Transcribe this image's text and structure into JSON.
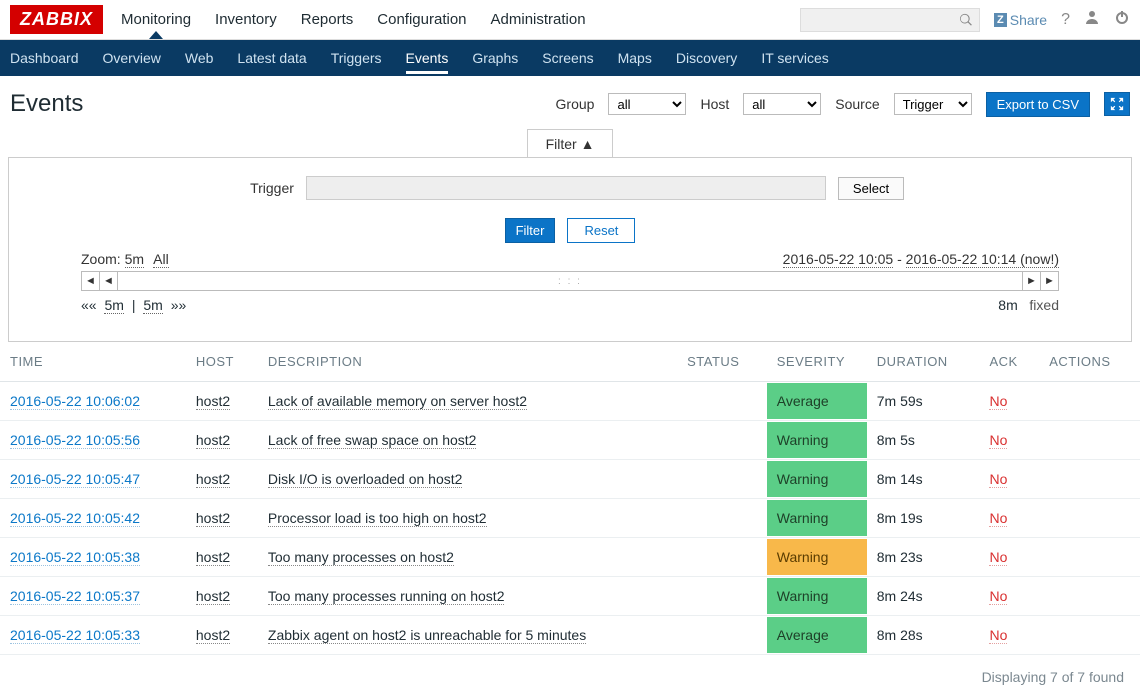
{
  "logo": "ZABBIX",
  "topnav": [
    {
      "label": "Monitoring",
      "active": true
    },
    {
      "label": "Inventory",
      "active": false
    },
    {
      "label": "Reports",
      "active": false
    },
    {
      "label": "Configuration",
      "active": false
    },
    {
      "label": "Administration",
      "active": false
    }
  ],
  "share_label": "Share",
  "subnav": [
    {
      "label": "Dashboard",
      "active": false
    },
    {
      "label": "Overview",
      "active": false
    },
    {
      "label": "Web",
      "active": false
    },
    {
      "label": "Latest data",
      "active": false
    },
    {
      "label": "Triggers",
      "active": false
    },
    {
      "label": "Events",
      "active": true
    },
    {
      "label": "Graphs",
      "active": false
    },
    {
      "label": "Screens",
      "active": false
    },
    {
      "label": "Maps",
      "active": false
    },
    {
      "label": "Discovery",
      "active": false
    },
    {
      "label": "IT services",
      "active": false
    }
  ],
  "page_title": "Events",
  "selects": {
    "group_label": "Group",
    "group_value": "all",
    "host_label": "Host",
    "host_value": "all",
    "source_label": "Source",
    "source_value": "Trigger"
  },
  "export_btn": "Export to CSV",
  "filter_tab": "Filter ▲",
  "filter": {
    "trigger_label": "Trigger",
    "select_btn": "Select",
    "filter_btn": "Filter",
    "reset_btn": "Reset"
  },
  "zoom": {
    "label": "Zoom:",
    "opt1": "5m",
    "opt2": "All",
    "range_from": "2016-05-22 10:05",
    "range_sep": " - ",
    "range_to": "2016-05-22 10:14 (now!)"
  },
  "zoom2": {
    "left_dbl_l": "««",
    "left_5m_a": "5m",
    "left_sep": " | ",
    "left_5m_b": "5m",
    "left_dbl_r": "»»",
    "right_8m": "8m",
    "right_fixed": "fixed"
  },
  "headers": {
    "time": "TIME",
    "host": "HOST",
    "description": "DESCRIPTION",
    "status": "STATUS",
    "severity": "SEVERITY",
    "duration": "DURATION",
    "ack": "ACK",
    "actions": "ACTIONS"
  },
  "rows": [
    {
      "time": "2016-05-22 10:06:02",
      "host": "host2",
      "desc": "Lack of available memory on server host2",
      "status": "",
      "sev": "Average",
      "sev_color": "green",
      "dur": "7m 59s",
      "ack": "No"
    },
    {
      "time": "2016-05-22 10:05:56",
      "host": "host2",
      "desc": "Lack of free swap space on host2",
      "status": "",
      "sev": "Warning",
      "sev_color": "green",
      "dur": "8m 5s",
      "ack": "No"
    },
    {
      "time": "2016-05-22 10:05:47",
      "host": "host2",
      "desc": "Disk I/O is overloaded on host2",
      "status": "",
      "sev": "Warning",
      "sev_color": "green",
      "dur": "8m 14s",
      "ack": "No"
    },
    {
      "time": "2016-05-22 10:05:42",
      "host": "host2",
      "desc": "Processor load is too high on host2",
      "status": "",
      "sev": "Warning",
      "sev_color": "green",
      "dur": "8m 19s",
      "ack": "No"
    },
    {
      "time": "2016-05-22 10:05:38",
      "host": "host2",
      "desc": "Too many processes on host2",
      "status": "",
      "sev": "Warning",
      "sev_color": "orange",
      "dur": "8m 23s",
      "ack": "No"
    },
    {
      "time": "2016-05-22 10:05:37",
      "host": "host2",
      "desc": "Too many processes running on host2",
      "status": "",
      "sev": "Warning",
      "sev_color": "green",
      "dur": "8m 24s",
      "ack": "No"
    },
    {
      "time": "2016-05-22 10:05:33",
      "host": "host2",
      "desc": "Zabbix agent on host2 is unreachable for 5 minutes",
      "status": "",
      "sev": "Average",
      "sev_color": "green",
      "dur": "8m 28s",
      "ack": "No"
    }
  ],
  "footer_count": "Displaying 7 of 7 found"
}
